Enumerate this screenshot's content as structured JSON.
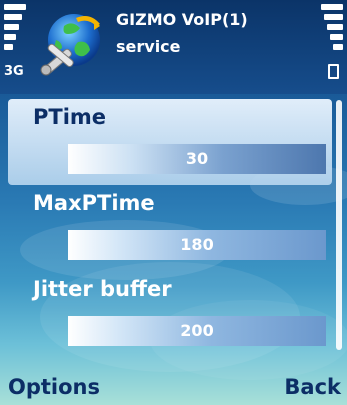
{
  "status": {
    "network_label": "3G"
  },
  "app": {
    "icon": "globe-tools-icon",
    "title_line1": "GIZMO VoIP(1)",
    "title_line2": "service"
  },
  "settings": [
    {
      "label": "PTime",
      "value": "30",
      "selected": true
    },
    {
      "label": "MaxPTime",
      "value": "180",
      "selected": false
    },
    {
      "label": "Jitter buffer",
      "value": "200",
      "selected": false
    }
  ],
  "softkeys": {
    "left": "Options",
    "right": "Back"
  },
  "colors": {
    "softkey_text": "#0c2e66",
    "selected_label": "#0c2e66"
  }
}
